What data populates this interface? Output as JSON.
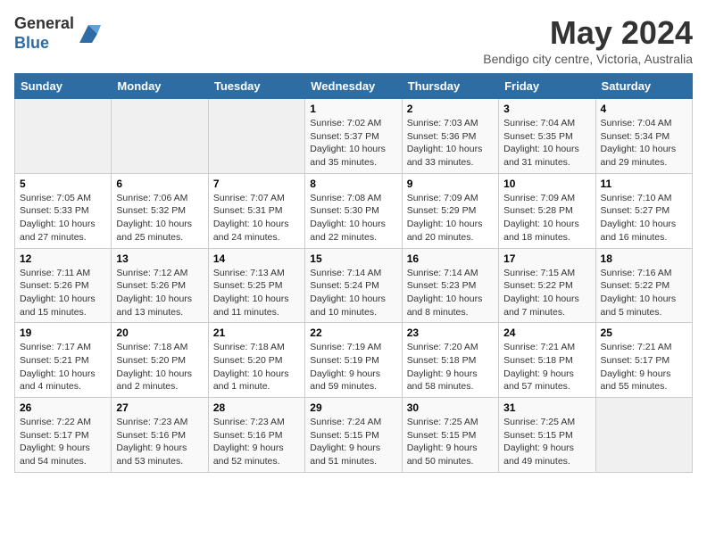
{
  "logo": {
    "general": "General",
    "blue": "Blue"
  },
  "header": {
    "month_year": "May 2024",
    "location": "Bendigo city centre, Victoria, Australia"
  },
  "days_of_week": [
    "Sunday",
    "Monday",
    "Tuesday",
    "Wednesday",
    "Thursday",
    "Friday",
    "Saturday"
  ],
  "weeks": [
    [
      {
        "day": "",
        "info": ""
      },
      {
        "day": "",
        "info": ""
      },
      {
        "day": "",
        "info": ""
      },
      {
        "day": "1",
        "info": "Sunrise: 7:02 AM\nSunset: 5:37 PM\nDaylight: 10 hours\nand 35 minutes."
      },
      {
        "day": "2",
        "info": "Sunrise: 7:03 AM\nSunset: 5:36 PM\nDaylight: 10 hours\nand 33 minutes."
      },
      {
        "day": "3",
        "info": "Sunrise: 7:04 AM\nSunset: 5:35 PM\nDaylight: 10 hours\nand 31 minutes."
      },
      {
        "day": "4",
        "info": "Sunrise: 7:04 AM\nSunset: 5:34 PM\nDaylight: 10 hours\nand 29 minutes."
      }
    ],
    [
      {
        "day": "5",
        "info": "Sunrise: 7:05 AM\nSunset: 5:33 PM\nDaylight: 10 hours\nand 27 minutes."
      },
      {
        "day": "6",
        "info": "Sunrise: 7:06 AM\nSunset: 5:32 PM\nDaylight: 10 hours\nand 25 minutes."
      },
      {
        "day": "7",
        "info": "Sunrise: 7:07 AM\nSunset: 5:31 PM\nDaylight: 10 hours\nand 24 minutes."
      },
      {
        "day": "8",
        "info": "Sunrise: 7:08 AM\nSunset: 5:30 PM\nDaylight: 10 hours\nand 22 minutes."
      },
      {
        "day": "9",
        "info": "Sunrise: 7:09 AM\nSunset: 5:29 PM\nDaylight: 10 hours\nand 20 minutes."
      },
      {
        "day": "10",
        "info": "Sunrise: 7:09 AM\nSunset: 5:28 PM\nDaylight: 10 hours\nand 18 minutes."
      },
      {
        "day": "11",
        "info": "Sunrise: 7:10 AM\nSunset: 5:27 PM\nDaylight: 10 hours\nand 16 minutes."
      }
    ],
    [
      {
        "day": "12",
        "info": "Sunrise: 7:11 AM\nSunset: 5:26 PM\nDaylight: 10 hours\nand 15 minutes."
      },
      {
        "day": "13",
        "info": "Sunrise: 7:12 AM\nSunset: 5:26 PM\nDaylight: 10 hours\nand 13 minutes."
      },
      {
        "day": "14",
        "info": "Sunrise: 7:13 AM\nSunset: 5:25 PM\nDaylight: 10 hours\nand 11 minutes."
      },
      {
        "day": "15",
        "info": "Sunrise: 7:14 AM\nSunset: 5:24 PM\nDaylight: 10 hours\nand 10 minutes."
      },
      {
        "day": "16",
        "info": "Sunrise: 7:14 AM\nSunset: 5:23 PM\nDaylight: 10 hours\nand 8 minutes."
      },
      {
        "day": "17",
        "info": "Sunrise: 7:15 AM\nSunset: 5:22 PM\nDaylight: 10 hours\nand 7 minutes."
      },
      {
        "day": "18",
        "info": "Sunrise: 7:16 AM\nSunset: 5:22 PM\nDaylight: 10 hours\nand 5 minutes."
      }
    ],
    [
      {
        "day": "19",
        "info": "Sunrise: 7:17 AM\nSunset: 5:21 PM\nDaylight: 10 hours\nand 4 minutes."
      },
      {
        "day": "20",
        "info": "Sunrise: 7:18 AM\nSunset: 5:20 PM\nDaylight: 10 hours\nand 2 minutes."
      },
      {
        "day": "21",
        "info": "Sunrise: 7:18 AM\nSunset: 5:20 PM\nDaylight: 10 hours\nand 1 minute."
      },
      {
        "day": "22",
        "info": "Sunrise: 7:19 AM\nSunset: 5:19 PM\nDaylight: 9 hours\nand 59 minutes."
      },
      {
        "day": "23",
        "info": "Sunrise: 7:20 AM\nSunset: 5:18 PM\nDaylight: 9 hours\nand 58 minutes."
      },
      {
        "day": "24",
        "info": "Sunrise: 7:21 AM\nSunset: 5:18 PM\nDaylight: 9 hours\nand 57 minutes."
      },
      {
        "day": "25",
        "info": "Sunrise: 7:21 AM\nSunset: 5:17 PM\nDaylight: 9 hours\nand 55 minutes."
      }
    ],
    [
      {
        "day": "26",
        "info": "Sunrise: 7:22 AM\nSunset: 5:17 PM\nDaylight: 9 hours\nand 54 minutes."
      },
      {
        "day": "27",
        "info": "Sunrise: 7:23 AM\nSunset: 5:16 PM\nDaylight: 9 hours\nand 53 minutes."
      },
      {
        "day": "28",
        "info": "Sunrise: 7:23 AM\nSunset: 5:16 PM\nDaylight: 9 hours\nand 52 minutes."
      },
      {
        "day": "29",
        "info": "Sunrise: 7:24 AM\nSunset: 5:15 PM\nDaylight: 9 hours\nand 51 minutes."
      },
      {
        "day": "30",
        "info": "Sunrise: 7:25 AM\nSunset: 5:15 PM\nDaylight: 9 hours\nand 50 minutes."
      },
      {
        "day": "31",
        "info": "Sunrise: 7:25 AM\nSunset: 5:15 PM\nDaylight: 9 hours\nand 49 minutes."
      },
      {
        "day": "",
        "info": ""
      }
    ]
  ]
}
